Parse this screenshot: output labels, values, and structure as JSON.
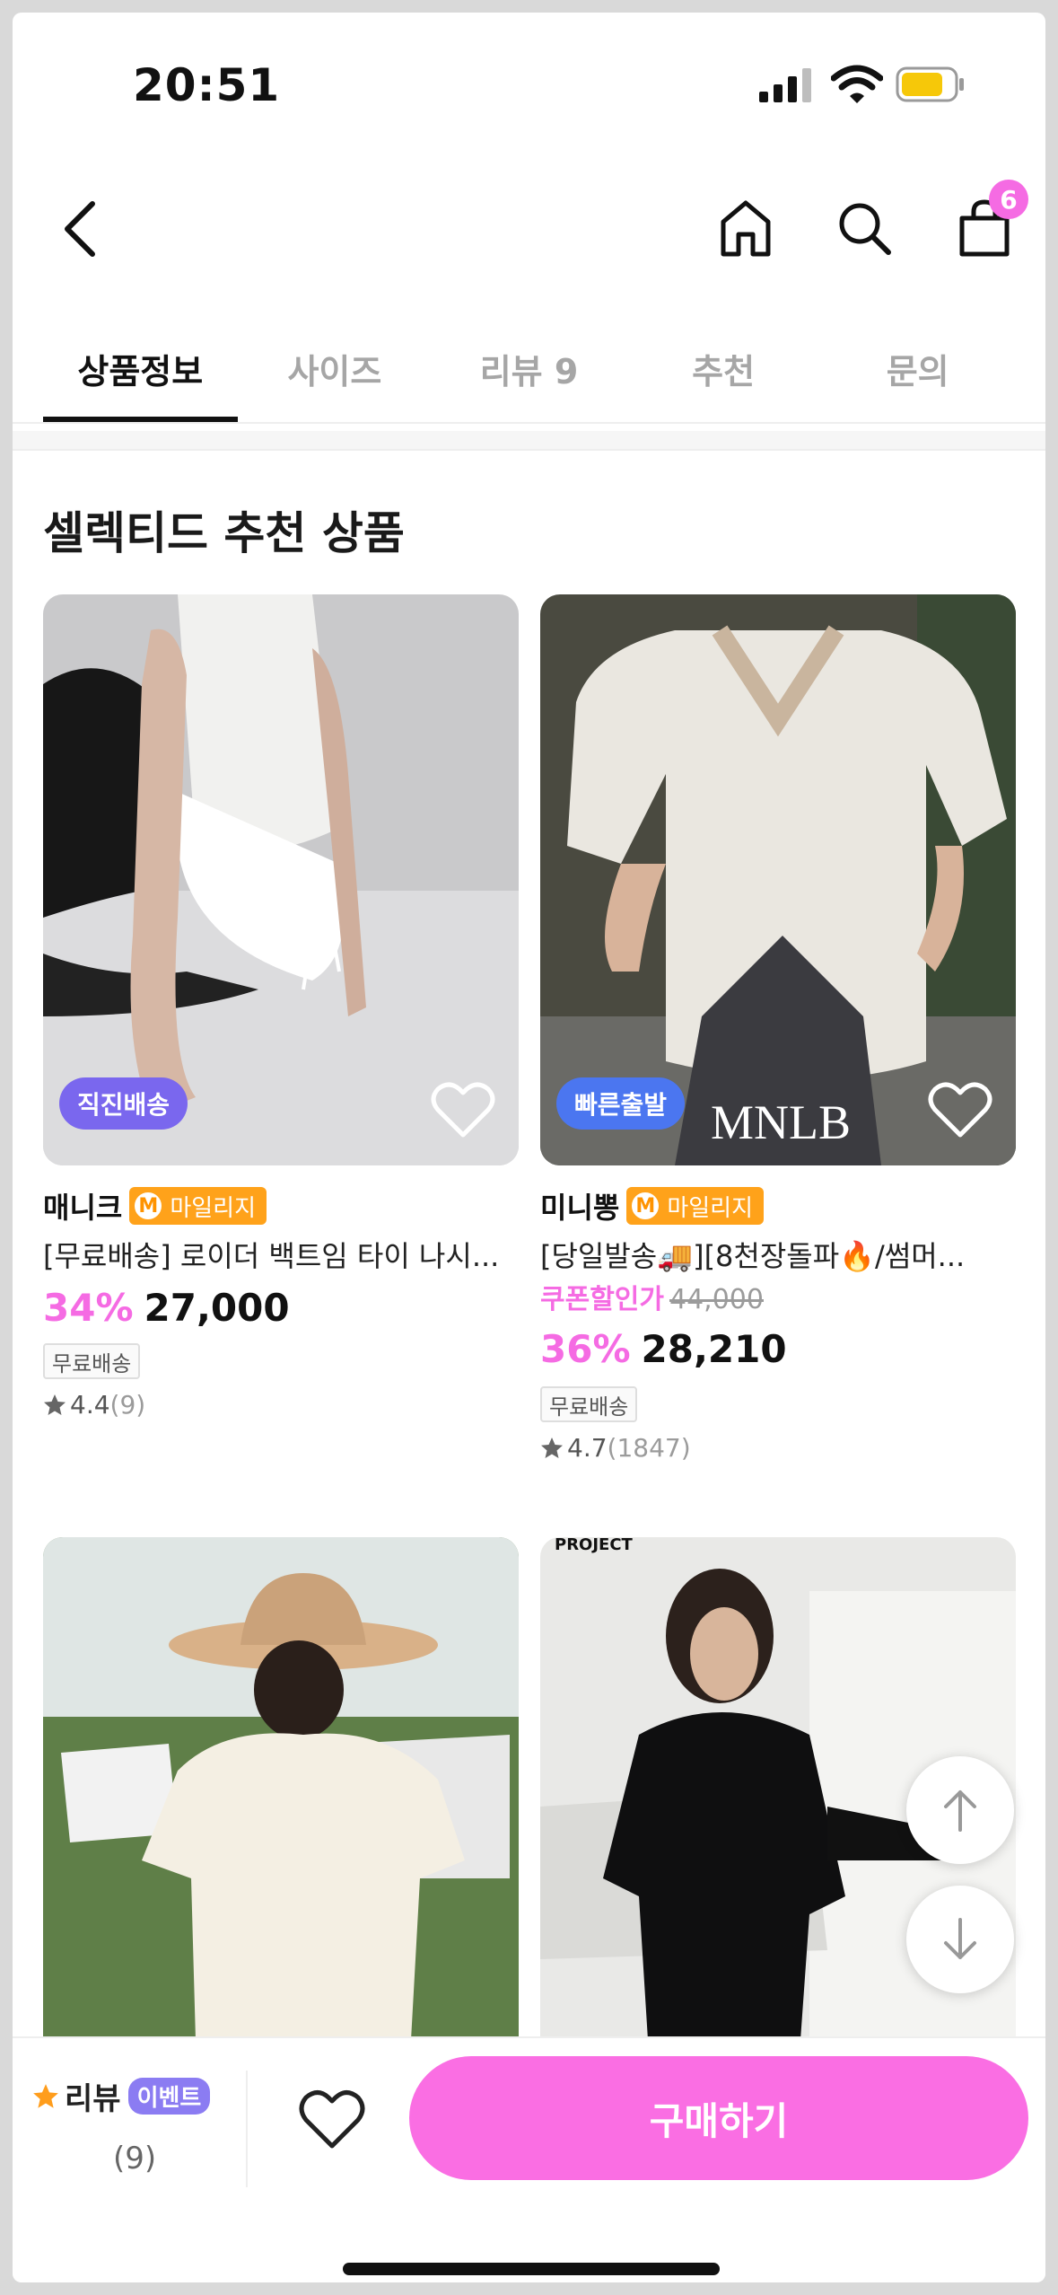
{
  "status_bar": {
    "time": "20:51"
  },
  "nav": {
    "cart_count": "6"
  },
  "tabs": [
    {
      "label": "상품정보",
      "active": true
    },
    {
      "label": "사이즈",
      "active": false
    },
    {
      "label": "리뷰 9",
      "active": false
    },
    {
      "label": "추천",
      "active": false
    },
    {
      "label": "문의",
      "active": false
    }
  ],
  "section": {
    "title": "셀렉티드 추천 상품"
  },
  "products": [
    {
      "tag": "직진배송",
      "tag_color": "#7a67ee",
      "brand": "매니크",
      "mileage": "마일리지",
      "mileage_icon": "M",
      "name": "[무료배송] 로이더 백트임 타이 나시...",
      "discount": "34%",
      "price": "27,000",
      "shipping": "무료배송",
      "rating": "4.4",
      "review_count": "(9)"
    },
    {
      "tag": "빠른출발",
      "tag_color": "#4b76f0",
      "watermark": "MNLB",
      "brand": "미니뽕",
      "mileage": "마일리지",
      "mileage_icon": "M",
      "name": "[당일발송🚚][8천장돌파🔥/썸머...",
      "coupon_label": "쿠폰할인가",
      "original_price": "44,000",
      "discount": "36%",
      "price": "28,210",
      "shipping": "무료배송",
      "rating": "4.7",
      "review_count": "(1847)"
    },
    {
      "top_text": "PROJECT"
    }
  ],
  "bottom_bar": {
    "review_label": "리뷰",
    "event_label": "이벤트",
    "review_count": "(9)",
    "buy_label": "구매하기"
  },
  "colors": {
    "accent_pink": "#f56be3",
    "mileage_orange": "#ffa21a",
    "event_purple": "#8b7cf2"
  }
}
